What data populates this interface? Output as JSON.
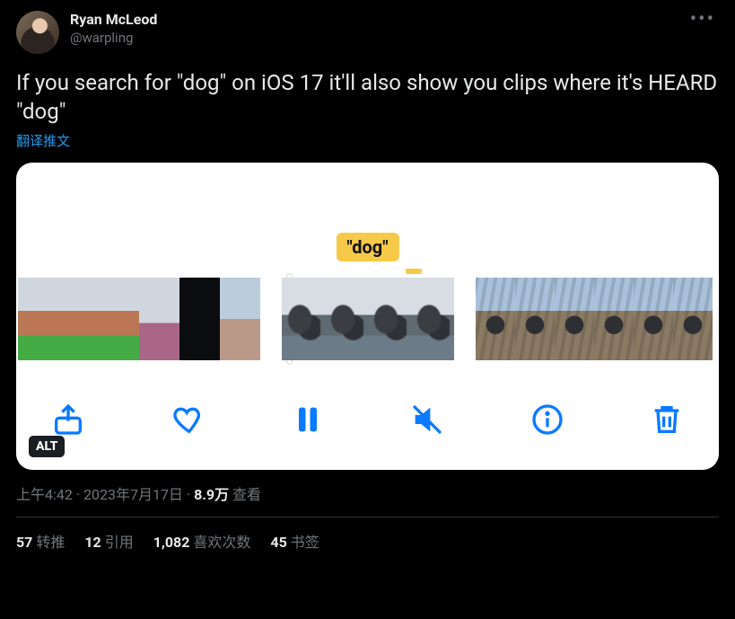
{
  "author": {
    "display_name": "Ryan McLeod",
    "handle": "@warpling"
  },
  "tweet_text": "If you search for \"dog\" on iOS 17 it'll also show you clips where it's HEARD \"dog\"",
  "translate_label": "翻译推文",
  "media": {
    "alt_badge": "ALT",
    "highlight_token": "\"dog\""
  },
  "meta": {
    "time": "上午4:42",
    "date": "2023年7月17日",
    "views_value": "8.9万",
    "views_label": "查看"
  },
  "stats": {
    "retweets": {
      "count": "57",
      "label": "转推"
    },
    "quotes": {
      "count": "12",
      "label": "引用"
    },
    "likes": {
      "count": "1,082",
      "label": "喜欢次数"
    },
    "bookmarks": {
      "count": "45",
      "label": "书签"
    }
  }
}
